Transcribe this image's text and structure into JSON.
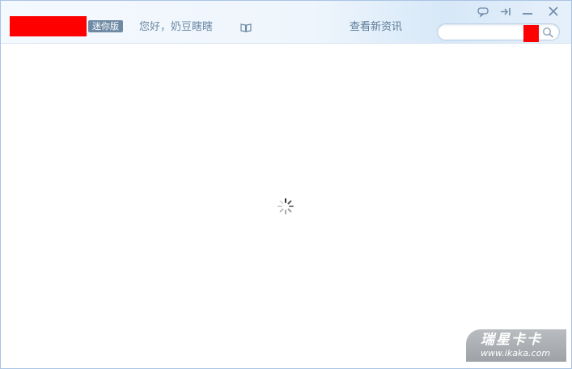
{
  "header": {
    "mini_badge": "迷你版",
    "greeting": "您好，奶豆瞎瞎",
    "news_link": "查看新资讯",
    "book_icon": "book-icon"
  },
  "search": {
    "value": "",
    "placeholder": "",
    "icon": "search-icon"
  },
  "window_controls": [
    {
      "name": "feedback",
      "icon": "speech-bubble-icon"
    },
    {
      "name": "pin",
      "icon": "pin-icon"
    },
    {
      "name": "minimize",
      "icon": "minimize-icon"
    },
    {
      "name": "close",
      "icon": "close-icon"
    }
  ],
  "content": {
    "state": "loading",
    "icon": "loading-spinner-icon"
  },
  "watermark": {
    "title": "瑞星卡卡",
    "url": "www.ikaka.com"
  },
  "colors": {
    "accent": "#6f8aa4",
    "link": "#5d7c98",
    "border": "#a9c4e4",
    "redaction": "#ff0000"
  }
}
